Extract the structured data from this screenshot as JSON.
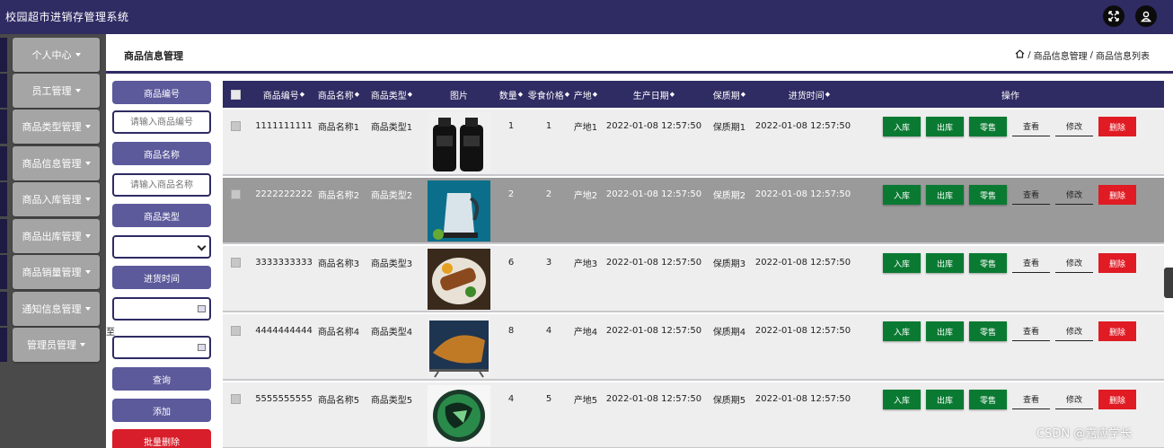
{
  "app": {
    "title": "校园超市进销存管理系统"
  },
  "sidebar": {
    "items": [
      {
        "label": "个人中心"
      },
      {
        "label": "员工管理"
      },
      {
        "label": "商品类型管理"
      },
      {
        "label": "商品信息管理"
      },
      {
        "label": "商品入库管理"
      },
      {
        "label": "商品出库管理"
      },
      {
        "label": "商品销量管理"
      },
      {
        "label": "通知信息管理"
      },
      {
        "label": "管理员管理"
      }
    ]
  },
  "header": {
    "title": "商品信息管理",
    "breadcrumb": [
      "商品信息管理",
      "商品信息列表"
    ],
    "breadcrumb_sep": "/"
  },
  "filters": {
    "code_label": "商品编号",
    "code_placeholder": "请输入商品编号",
    "name_label": "商品名称",
    "name_placeholder": "请输入商品名称",
    "type_label": "商品类型",
    "type_value": "",
    "date_label": "进货时间",
    "to_label": "至",
    "query_button": "查询",
    "add_button": "添加",
    "batch_delete_button": "批量删除"
  },
  "table": {
    "headers": [
      "商品编号",
      "商品名称",
      "商品类型",
      "图片",
      "数量",
      "零食价格",
      "产地",
      "生产日期",
      "保质期",
      "进货时间",
      "操作"
    ],
    "sortable": [
      "商品编号",
      "商品名称",
      "商品类型",
      "数量",
      "零食价格",
      "产地",
      "生产日期",
      "保质期",
      "进货时间"
    ],
    "actions": {
      "stock_in": "入库",
      "stock_out": "出库",
      "retail": "零售",
      "view": "查看",
      "edit": "修改",
      "delete": "删除"
    },
    "rows": [
      {
        "code": "1111111111",
        "name": "商品名称1",
        "type": "商品类型1",
        "image": "shampoo-bottles",
        "qty": "1",
        "price": "1",
        "origin": "产地1",
        "prod_date": "2022-01-08 12:57:50",
        "shelf": "保质期1",
        "in_time": "2022-01-08 12:57:50"
      },
      {
        "code": "2222222222",
        "name": "商品名称2",
        "type": "商品类型2",
        "image": "electric-kettle",
        "qty": "2",
        "price": "2",
        "origin": "产地2",
        "prod_date": "2022-01-08 12:57:50",
        "shelf": "保质期2",
        "in_time": "2022-01-08 12:57:50"
      },
      {
        "code": "3333333333",
        "name": "商品名称3",
        "type": "商品类型3",
        "image": "food-plate",
        "qty": "6",
        "price": "3",
        "origin": "产地3",
        "prod_date": "2022-01-08 12:57:50",
        "shelf": "保质期3",
        "in_time": "2022-01-08 12:57:50"
      },
      {
        "code": "4444444444",
        "name": "商品名称4",
        "type": "商品类型4",
        "image": "tv-fish",
        "qty": "8",
        "price": "4",
        "origin": "产地4",
        "prod_date": "2022-01-08 12:57:50",
        "shelf": "保质期4",
        "in_time": "2022-01-08 12:57:50"
      },
      {
        "code": "5555555555",
        "name": "商品名称5",
        "type": "商品类型5",
        "image": "green-ball",
        "qty": "4",
        "price": "5",
        "origin": "产地5",
        "prod_date": "2022-01-08 12:57:50",
        "shelf": "保质期5",
        "in_time": "2022-01-08 12:57:50"
      }
    ]
  },
  "watermark": "CSDN @嘉应学长",
  "icons": {
    "fullscreen": "fullscreen-icon",
    "user": "user-icon",
    "home": "home-icon",
    "calendar": "calendar-icon"
  },
  "colors": {
    "primary": "#2f2b63",
    "button": "#5c5a9b",
    "green": "#0a7a32",
    "red": "#e01b24",
    "sidebar": "#4a4a4a"
  }
}
